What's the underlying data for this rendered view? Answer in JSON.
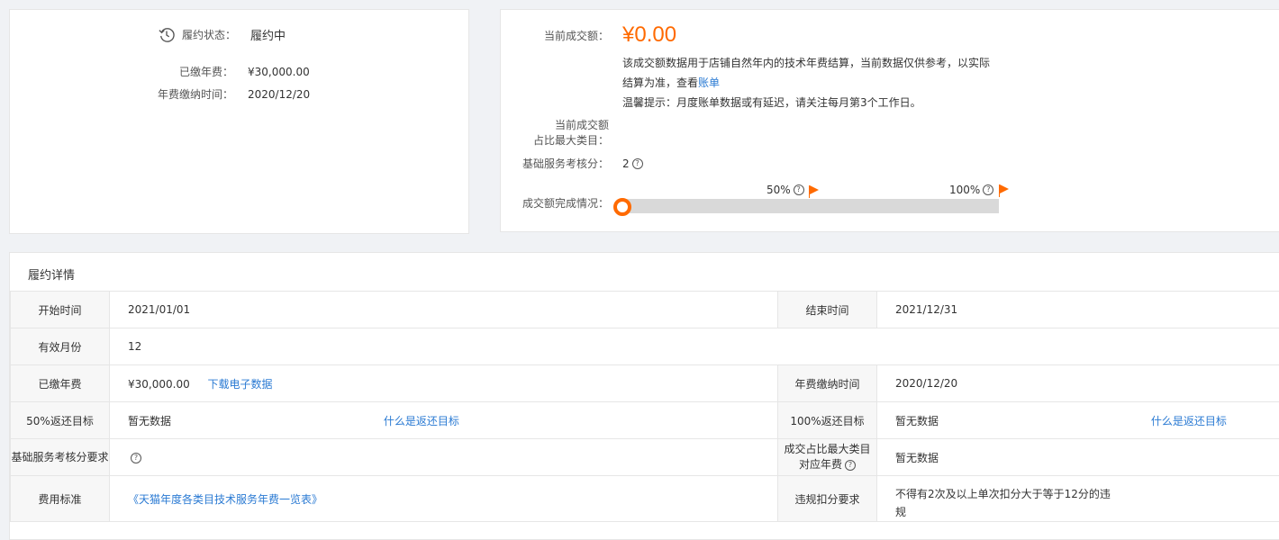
{
  "status_card": {
    "status_label": "履约状态：",
    "status_value": "履约中",
    "paid_label": "已缴年费：",
    "paid_value": "¥30,000.00",
    "paid_time_label": "年费缴纳时间：",
    "paid_time_value": "2020/12/20"
  },
  "sales_card": {
    "current_amount_label": "当前成交额：",
    "current_amount_value": "¥0.00",
    "note_line1": "该成交额数据用于店铺自然年内的技术年费结算，当前数据仅供参考，以实际",
    "note_line2_prefix": "结算为准，查看",
    "note_link": "账单",
    "tip": "温馨提示：月度账单数据或有延迟，请关注每月第3个工作日。",
    "top_category_label_line1": "当前成交额",
    "top_category_label_line2": "占比最大类目：",
    "base_score_label": "基础服务考核分：",
    "base_score_value": "2",
    "progress_label": "成交额完成情况：",
    "progress_fraction": 0,
    "milestone_50": "50%",
    "milestone_100": "100%",
    "accent_color": "#ff6a00"
  },
  "detail": {
    "title": "履约详情",
    "start_label": "开始时间",
    "start_value": "2021/01/01",
    "end_label": "结束时间",
    "end_value": "2021/12/31",
    "months_label": "有效月份",
    "months_value": "12",
    "paid_label": "已缴年费",
    "paid_value": "¥30,000.00",
    "download_link": "下载电子数据",
    "paid_time_label": "年费缴纳时间",
    "paid_time_value": "2020/12/20",
    "rebate50_label": "50%返还目标",
    "rebate50_value": "暂无数据",
    "rebate_help_link": "什么是返还目标",
    "rebate100_label": "100%返还目标",
    "rebate100_value": "暂无数据",
    "base_score_req_label": "基础服务考核分要求",
    "top_cat_fee_label_line1": "成交占比最大类目",
    "top_cat_fee_label_line2": "对应年费",
    "top_cat_fee_value": "暂无数据",
    "fee_standard_label": "费用标准",
    "fee_standard_link": "《天猫年度各类目技术服务年费一览表》",
    "violation_label": "违规扣分要求",
    "violation_value_line1": "不得有2次及以上单次扣分大于等于12分的违",
    "violation_value_line2": "规"
  }
}
